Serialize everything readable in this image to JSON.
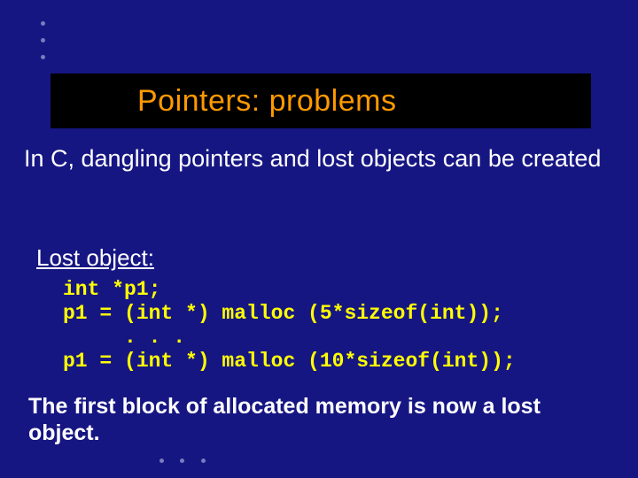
{
  "title": "Pointers:  problems",
  "intro": "In C, dangling pointers and lost objects can be created",
  "subheading": "Lost object:",
  "code": "int *p1;\np1 = (int *) malloc (5*sizeof(int));\n     . . .\np1 = (int *) malloc (10*sizeof(int));",
  "conclusion": "The first block of allocated memory is now a lost object."
}
